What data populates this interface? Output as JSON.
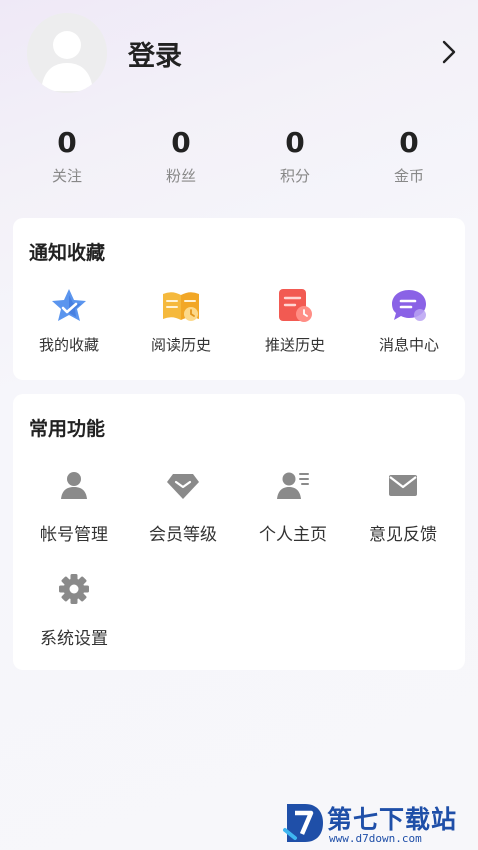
{
  "header": {
    "login_label": "登录"
  },
  "stats": [
    {
      "value": "0",
      "label": "关注"
    },
    {
      "value": "0",
      "label": "粉丝"
    },
    {
      "value": "0",
      "label": "积分"
    },
    {
      "value": "0",
      "label": "金币"
    }
  ],
  "notify": {
    "title": "通知收藏",
    "items": [
      {
        "label": "我的收藏",
        "icon": "star-icon"
      },
      {
        "label": "阅读历史",
        "icon": "book-icon"
      },
      {
        "label": "推送历史",
        "icon": "push-history-icon"
      },
      {
        "label": "消息中心",
        "icon": "message-icon"
      }
    ]
  },
  "common": {
    "title": "常用功能",
    "items": [
      {
        "label": "帐号管理",
        "icon": "user-icon"
      },
      {
        "label": "会员等级",
        "icon": "diamond-icon"
      },
      {
        "label": "个人主页",
        "icon": "profile-card-icon"
      },
      {
        "label": "意见反馈",
        "icon": "mail-icon"
      },
      {
        "label": "系统设置",
        "icon": "gear-icon"
      }
    ]
  },
  "watermark": {
    "title": "第七下载站",
    "url": "www.d7down.com"
  },
  "colors": {
    "star": "#4a86e8",
    "book": "#f2b133",
    "push": "#ef4f4a",
    "message": "#8a62e6",
    "gray_icon": "#8a8a8a",
    "brand": "#1f4fa8"
  }
}
